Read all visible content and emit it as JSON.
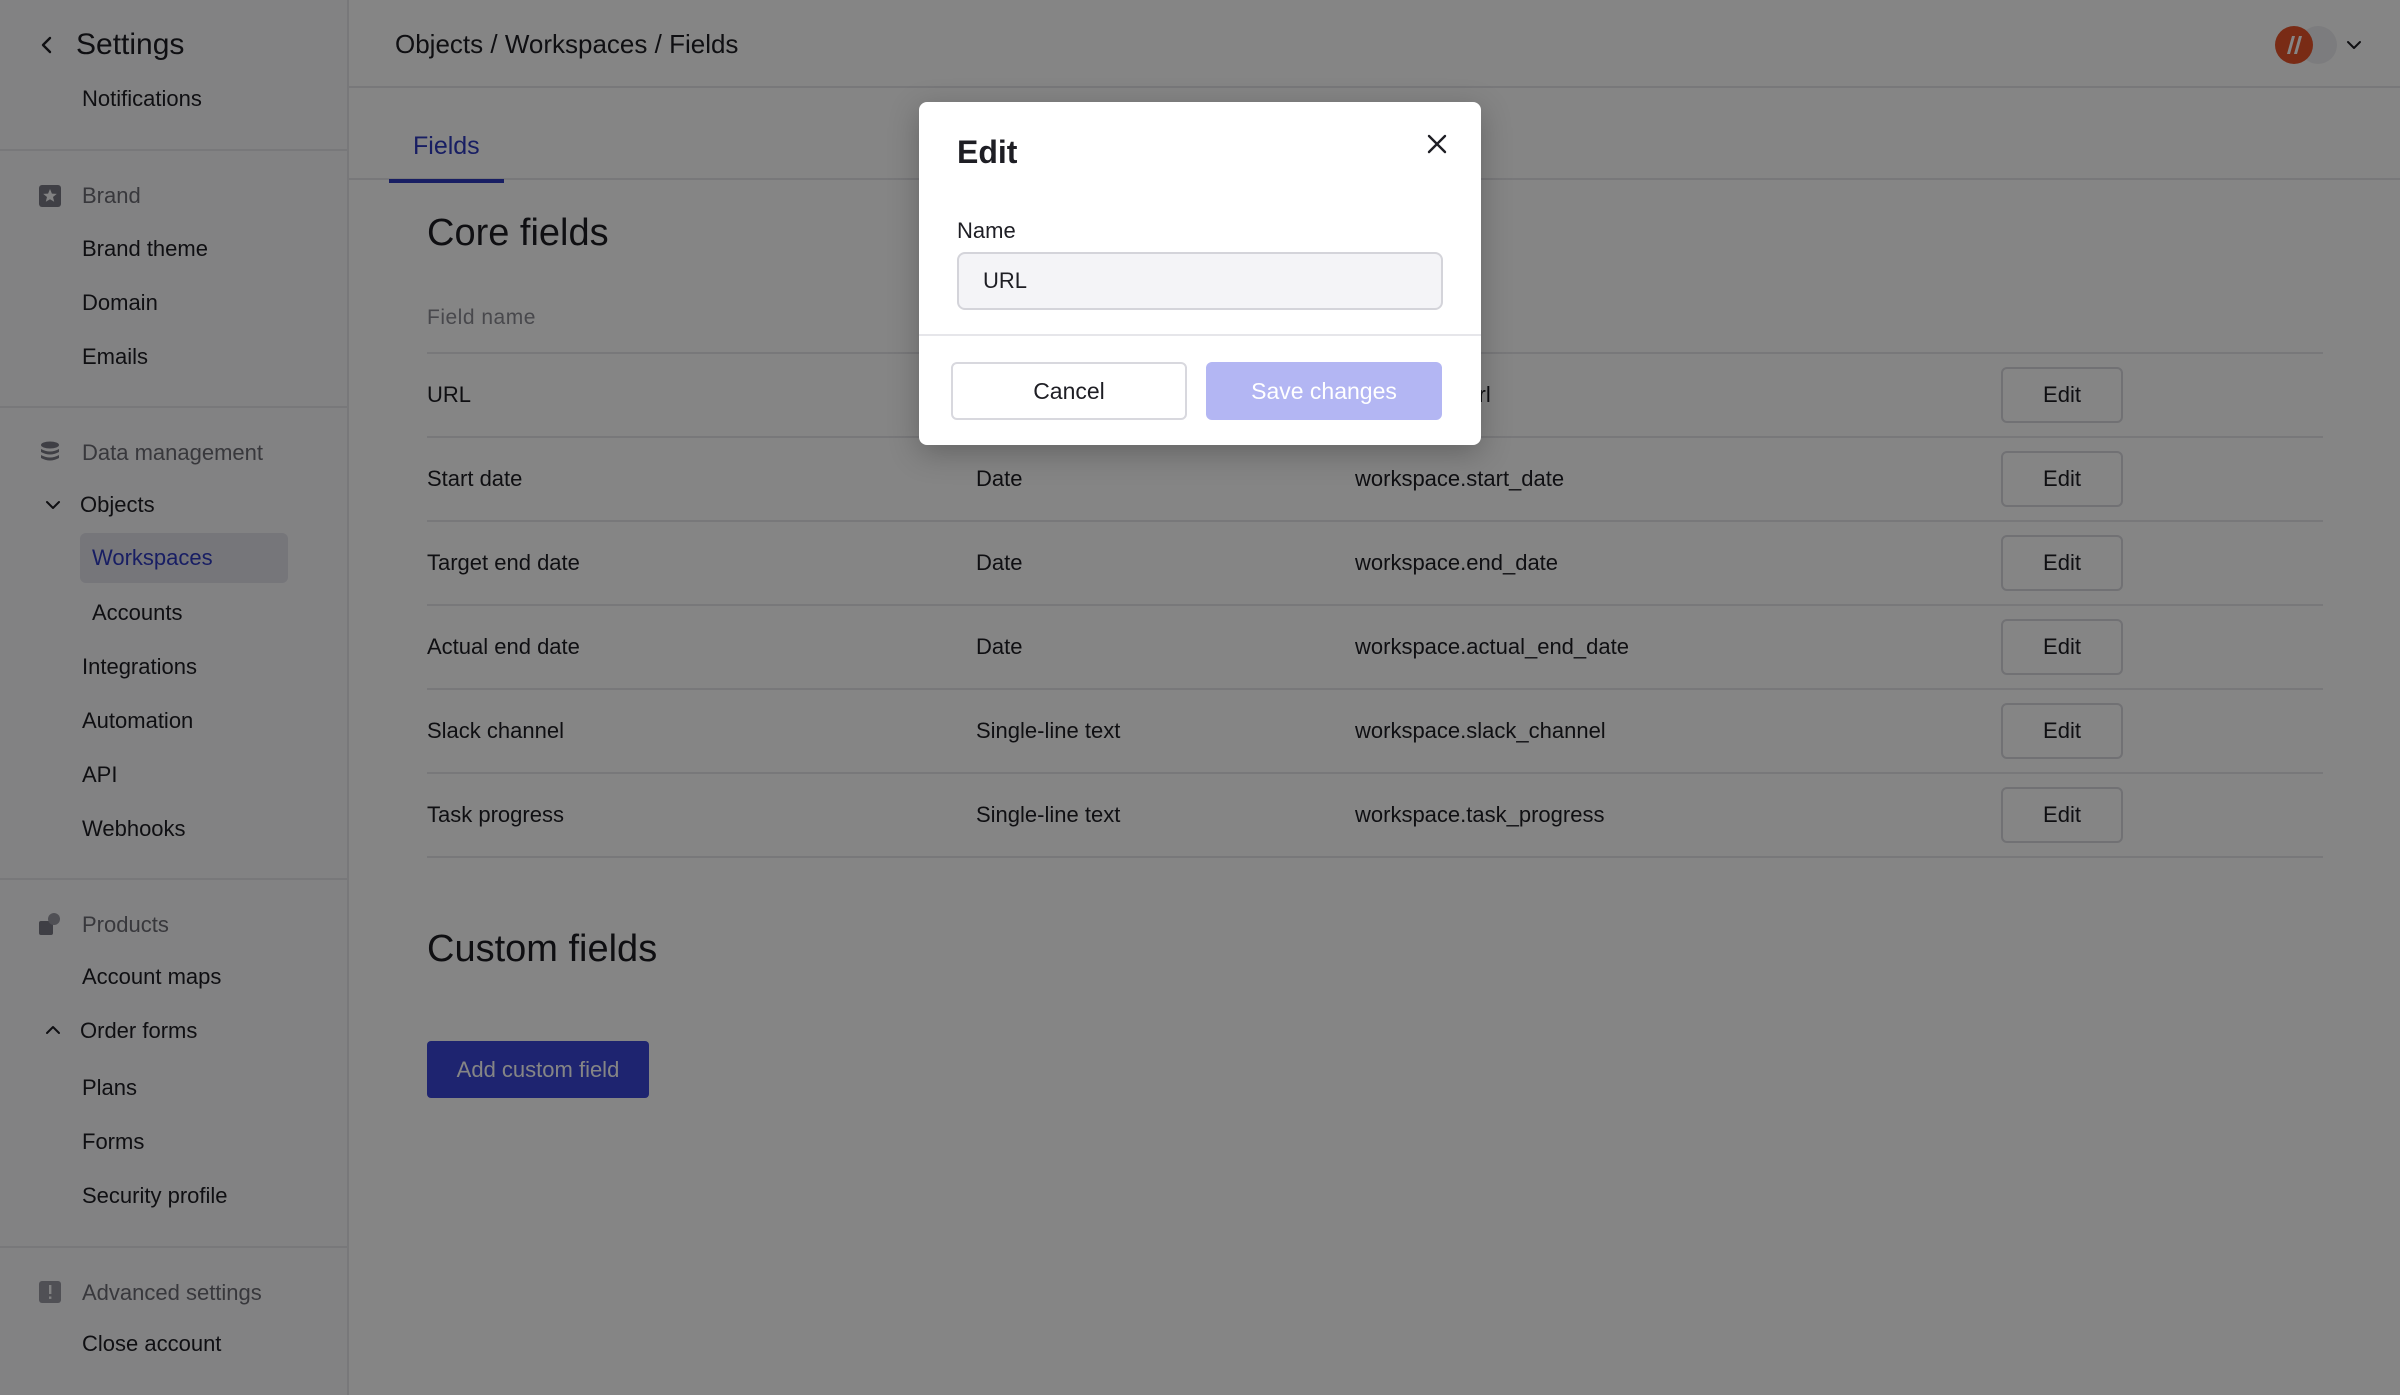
{
  "app": {
    "title": "Settings"
  },
  "sidebar": {
    "top_item": "Notifications",
    "brand": {
      "label": "Brand",
      "items": [
        "Brand theme",
        "Domain",
        "Emails"
      ]
    },
    "data_management": {
      "label": "Data management",
      "objects": {
        "label": "Objects",
        "items": [
          "Workspaces",
          "Accounts"
        ]
      },
      "items": [
        "Integrations",
        "Automation",
        "API",
        "Webhooks"
      ]
    },
    "products": {
      "label": "Products",
      "items_before": [
        "Account maps"
      ],
      "order_forms": {
        "label": "Order forms",
        "items": [
          "Plans",
          "Forms"
        ]
      },
      "items_after": [
        "Security profile"
      ]
    },
    "advanced": {
      "label": "Advanced settings",
      "items": [
        "Close account"
      ]
    }
  },
  "header": {
    "breadcrumb": [
      "Objects",
      "Workspaces",
      "Fields"
    ],
    "separator": " / "
  },
  "tabs": [
    {
      "label": "Fields",
      "active": true
    }
  ],
  "core": {
    "title": "Core fields",
    "column_header": "Field name",
    "edit_label": "Edit",
    "rows": [
      {
        "name": "URL",
        "type": "",
        "key": "workspace.url"
      },
      {
        "name": "Start date",
        "type": "Date",
        "key": "workspace.start_date"
      },
      {
        "name": "Target end date",
        "type": "Date",
        "key": "workspace.end_date"
      },
      {
        "name": "Actual end date",
        "type": "Date",
        "key": "workspace.actual_end_date"
      },
      {
        "name": "Slack channel",
        "type": "Single-line text",
        "key": "workspace.slack_channel"
      },
      {
        "name": "Task progress",
        "type": "Single-line text",
        "key": "workspace.task_progress"
      }
    ]
  },
  "custom": {
    "title": "Custom fields",
    "add_label": "Add custom field"
  },
  "modal": {
    "title": "Edit",
    "field_label": "Name",
    "field_value": "URL",
    "cancel_label": "Cancel",
    "save_label": "Save changes"
  },
  "colors": {
    "accent": "#3a45d6",
    "active_text": "#2e3abf",
    "save_disabled": "#b3b6f3",
    "avatar": "#e8542a"
  }
}
